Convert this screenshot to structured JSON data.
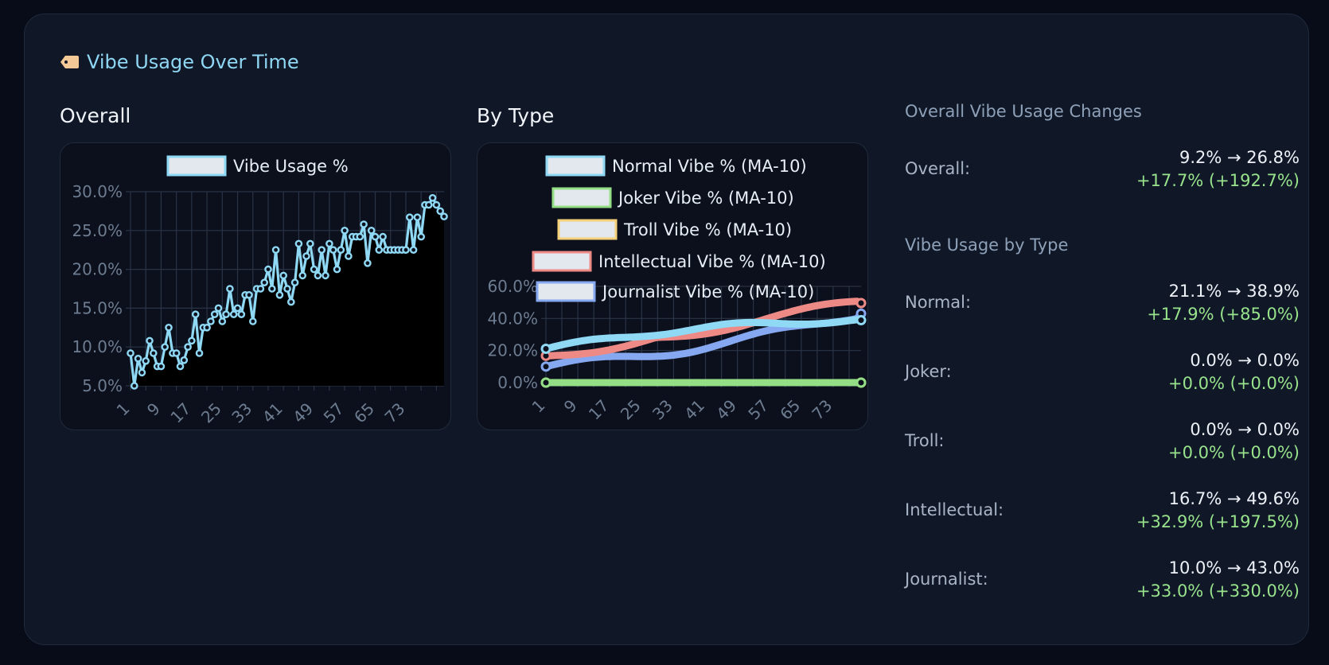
{
  "card": {
    "title": "Vibe Usage Over Time",
    "icon": "tag-icon"
  },
  "sections": {
    "overall": "Overall",
    "by_type": "By Type"
  },
  "stats": {
    "overall_heading": "Overall Vibe Usage Changes",
    "type_heading": "Vibe Usage by Type",
    "rows": [
      {
        "label": "Overall:",
        "range": "9.2% → 26.8%",
        "change": "+17.7% (+192.7%)"
      },
      {
        "label": "Normal:",
        "range": "21.1% → 38.9%",
        "change": "+17.9% (+85.0%)"
      },
      {
        "label": "Joker:",
        "range": "0.0% → 0.0%",
        "change": "+0.0% (+0.0%)"
      },
      {
        "label": "Troll:",
        "range": "0.0% → 0.0%",
        "change": "+0.0% (+0.0%)"
      },
      {
        "label": "Intellectual:",
        "range": "16.7% → 49.6%",
        "change": "+32.9% (+197.5%)"
      },
      {
        "label": "Journalist:",
        "range": "10.0% → 43.0%",
        "change": "+33.0% (+330.0%)"
      }
    ]
  },
  "colors": {
    "normal": "#8fd9f5",
    "joker": "#94df86",
    "troll": "#f5d27a",
    "intellectual": "#ee8a86",
    "journalist": "#86a8f0",
    "change": "#98e38c"
  },
  "chart_data": [
    {
      "type": "line",
      "legend": "top",
      "grid": true,
      "ylim": [
        5,
        30
      ],
      "y_ticks": [
        "30.0%",
        "25.0%",
        "20.0%",
        "15.0%",
        "10.0%",
        "5.0%"
      ],
      "x_ticks": [
        "1",
        "9",
        "17",
        "25",
        "33",
        "41",
        "49",
        "57",
        "65",
        "73"
      ],
      "series": [
        {
          "name": "Vibe Usage %",
          "color": "#8fd9f5",
          "values": [
            9.2,
            5,
            8.5,
            6.7,
            8.2,
            10.8,
            9.2,
            7.5,
            7.5,
            10,
            12.5,
            9.2,
            9.2,
            7.5,
            8.3,
            10,
            10.8,
            14.2,
            9.2,
            12.5,
            12.5,
            13.3,
            14.2,
            15,
            13.3,
            14.2,
            17.5,
            14.2,
            15,
            14.2,
            16.7,
            16.7,
            13.3,
            17.5,
            17.5,
            18.3,
            20,
            17.5,
            22.5,
            16.7,
            19.2,
            17.5,
            15.8,
            18.3,
            23.3,
            19.2,
            21.7,
            23.3,
            20,
            19.2,
            22.5,
            19.2,
            23.3,
            22.5,
            20,
            22.5,
            25,
            21.7,
            24.2,
            24.2,
            24.2,
            25.8,
            20.8,
            25,
            24.2,
            22.5,
            24.2,
            22.5,
            22.5,
            22.5,
            22.5,
            22.5,
            22.5,
            26.7,
            22.5,
            26.7,
            24.2,
            28.3,
            28.3,
            29.2,
            28.3,
            27.5,
            26.8
          ]
        }
      ]
    },
    {
      "type": "line",
      "legend": "top",
      "grid": true,
      "ylim": [
        0,
        60
      ],
      "y_ticks": [
        "60.0%",
        "40.0%",
        "20.0%",
        "0.0%"
      ],
      "x_ticks": [
        "1",
        "9",
        "17",
        "25",
        "33",
        "41",
        "49",
        "57",
        "65",
        "73"
      ],
      "series": [
        {
          "name": "Normal Vibe % (MA-10)",
          "color": "#8fd9f5",
          "start": 21.1,
          "end": 38.9
        },
        {
          "name": "Joker Vibe % (MA-10)",
          "color": "#94df86",
          "start": 0,
          "end": 0
        },
        {
          "name": "Troll Vibe % (MA-10)",
          "color": "#f5d27a",
          "start": 0,
          "end": 0
        },
        {
          "name": "Intellectual Vibe % (MA-10)",
          "color": "#ee8a86",
          "start": 16.7,
          "end": 49.6
        },
        {
          "name": "Journalist Vibe % (MA-10)",
          "color": "#86a8f0",
          "start": 10,
          "end": 43
        }
      ]
    }
  ]
}
